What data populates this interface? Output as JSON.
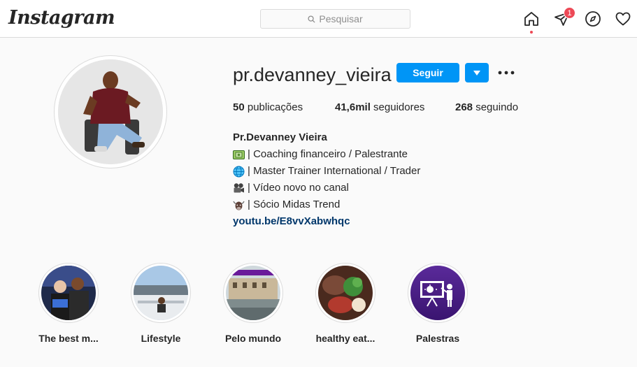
{
  "header": {
    "logo": "Instagram",
    "search_placeholder": "Pesquisar",
    "notification_count": "1"
  },
  "profile": {
    "username": "pr.devanney_vieira",
    "follow_label": "Seguir",
    "stats": [
      {
        "value": "50",
        "label": "publicações"
      },
      {
        "value": "41,6mil",
        "label": "seguidores"
      },
      {
        "value": "268",
        "label": "seguindo"
      }
    ],
    "full_name": "Pr.Devanney Vieira",
    "bio_lines": [
      {
        "icon": "money-emoji-icon",
        "text": "| Coaching financeiro / Palestrante"
      },
      {
        "icon": "globe-emoji-icon",
        "text": "| Master Trainer International / Trader"
      },
      {
        "icon": "camera-emoji-icon",
        "text": "| Vídeo novo no canal"
      },
      {
        "icon": "bull-emoji-icon",
        "text": "| Sócio Midas Trend"
      }
    ],
    "link": "youtu.be/E8vvXabwhqc"
  },
  "highlights": [
    {
      "label": "The best m..."
    },
    {
      "label": "Lifestyle"
    },
    {
      "label": "Pelo mundo"
    },
    {
      "label": "healthy eat..."
    },
    {
      "label": "Palestras"
    }
  ],
  "colors": {
    "accent": "#0095f6",
    "badge": "#ed4956",
    "link": "#00376b",
    "palestras_bg": "#4b1e83"
  }
}
